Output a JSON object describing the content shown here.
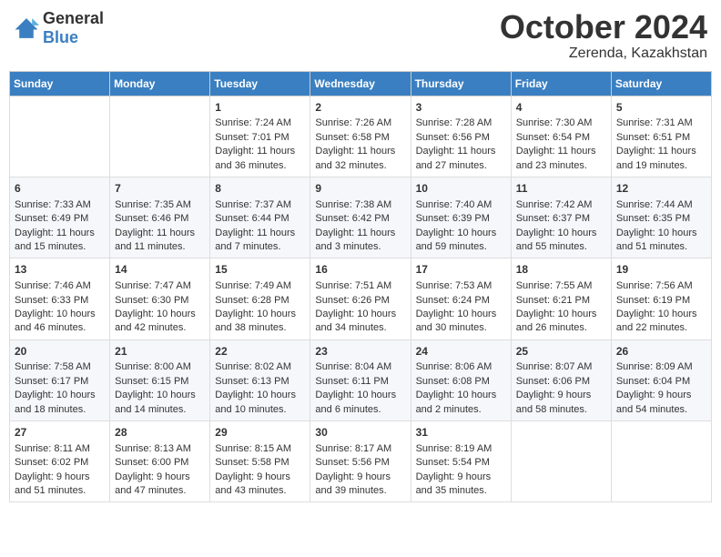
{
  "logo": {
    "general": "General",
    "blue": "Blue"
  },
  "title": "October 2024",
  "location": "Zerenda, Kazakhstan",
  "days_of_week": [
    "Sunday",
    "Monday",
    "Tuesday",
    "Wednesday",
    "Thursday",
    "Friday",
    "Saturday"
  ],
  "weeks": [
    [
      {
        "day": "",
        "sunrise": "",
        "sunset": "",
        "daylight": ""
      },
      {
        "day": "",
        "sunrise": "",
        "sunset": "",
        "daylight": ""
      },
      {
        "day": "1",
        "sunrise": "Sunrise: 7:24 AM",
        "sunset": "Sunset: 7:01 PM",
        "daylight": "Daylight: 11 hours and 36 minutes."
      },
      {
        "day": "2",
        "sunrise": "Sunrise: 7:26 AM",
        "sunset": "Sunset: 6:58 PM",
        "daylight": "Daylight: 11 hours and 32 minutes."
      },
      {
        "day": "3",
        "sunrise": "Sunrise: 7:28 AM",
        "sunset": "Sunset: 6:56 PM",
        "daylight": "Daylight: 11 hours and 27 minutes."
      },
      {
        "day": "4",
        "sunrise": "Sunrise: 7:30 AM",
        "sunset": "Sunset: 6:54 PM",
        "daylight": "Daylight: 11 hours and 23 minutes."
      },
      {
        "day": "5",
        "sunrise": "Sunrise: 7:31 AM",
        "sunset": "Sunset: 6:51 PM",
        "daylight": "Daylight: 11 hours and 19 minutes."
      }
    ],
    [
      {
        "day": "6",
        "sunrise": "Sunrise: 7:33 AM",
        "sunset": "Sunset: 6:49 PM",
        "daylight": "Daylight: 11 hours and 15 minutes."
      },
      {
        "day": "7",
        "sunrise": "Sunrise: 7:35 AM",
        "sunset": "Sunset: 6:46 PM",
        "daylight": "Daylight: 11 hours and 11 minutes."
      },
      {
        "day": "8",
        "sunrise": "Sunrise: 7:37 AM",
        "sunset": "Sunset: 6:44 PM",
        "daylight": "Daylight: 11 hours and 7 minutes."
      },
      {
        "day": "9",
        "sunrise": "Sunrise: 7:38 AM",
        "sunset": "Sunset: 6:42 PM",
        "daylight": "Daylight: 11 hours and 3 minutes."
      },
      {
        "day": "10",
        "sunrise": "Sunrise: 7:40 AM",
        "sunset": "Sunset: 6:39 PM",
        "daylight": "Daylight: 10 hours and 59 minutes."
      },
      {
        "day": "11",
        "sunrise": "Sunrise: 7:42 AM",
        "sunset": "Sunset: 6:37 PM",
        "daylight": "Daylight: 10 hours and 55 minutes."
      },
      {
        "day": "12",
        "sunrise": "Sunrise: 7:44 AM",
        "sunset": "Sunset: 6:35 PM",
        "daylight": "Daylight: 10 hours and 51 minutes."
      }
    ],
    [
      {
        "day": "13",
        "sunrise": "Sunrise: 7:46 AM",
        "sunset": "Sunset: 6:33 PM",
        "daylight": "Daylight: 10 hours and 46 minutes."
      },
      {
        "day": "14",
        "sunrise": "Sunrise: 7:47 AM",
        "sunset": "Sunset: 6:30 PM",
        "daylight": "Daylight: 10 hours and 42 minutes."
      },
      {
        "day": "15",
        "sunrise": "Sunrise: 7:49 AM",
        "sunset": "Sunset: 6:28 PM",
        "daylight": "Daylight: 10 hours and 38 minutes."
      },
      {
        "day": "16",
        "sunrise": "Sunrise: 7:51 AM",
        "sunset": "Sunset: 6:26 PM",
        "daylight": "Daylight: 10 hours and 34 minutes."
      },
      {
        "day": "17",
        "sunrise": "Sunrise: 7:53 AM",
        "sunset": "Sunset: 6:24 PM",
        "daylight": "Daylight: 10 hours and 30 minutes."
      },
      {
        "day": "18",
        "sunrise": "Sunrise: 7:55 AM",
        "sunset": "Sunset: 6:21 PM",
        "daylight": "Daylight: 10 hours and 26 minutes."
      },
      {
        "day": "19",
        "sunrise": "Sunrise: 7:56 AM",
        "sunset": "Sunset: 6:19 PM",
        "daylight": "Daylight: 10 hours and 22 minutes."
      }
    ],
    [
      {
        "day": "20",
        "sunrise": "Sunrise: 7:58 AM",
        "sunset": "Sunset: 6:17 PM",
        "daylight": "Daylight: 10 hours and 18 minutes."
      },
      {
        "day": "21",
        "sunrise": "Sunrise: 8:00 AM",
        "sunset": "Sunset: 6:15 PM",
        "daylight": "Daylight: 10 hours and 14 minutes."
      },
      {
        "day": "22",
        "sunrise": "Sunrise: 8:02 AM",
        "sunset": "Sunset: 6:13 PM",
        "daylight": "Daylight: 10 hours and 10 minutes."
      },
      {
        "day": "23",
        "sunrise": "Sunrise: 8:04 AM",
        "sunset": "Sunset: 6:11 PM",
        "daylight": "Daylight: 10 hours and 6 minutes."
      },
      {
        "day": "24",
        "sunrise": "Sunrise: 8:06 AM",
        "sunset": "Sunset: 6:08 PM",
        "daylight": "Daylight: 10 hours and 2 minutes."
      },
      {
        "day": "25",
        "sunrise": "Sunrise: 8:07 AM",
        "sunset": "Sunset: 6:06 PM",
        "daylight": "Daylight: 9 hours and 58 minutes."
      },
      {
        "day": "26",
        "sunrise": "Sunrise: 8:09 AM",
        "sunset": "Sunset: 6:04 PM",
        "daylight": "Daylight: 9 hours and 54 minutes."
      }
    ],
    [
      {
        "day": "27",
        "sunrise": "Sunrise: 8:11 AM",
        "sunset": "Sunset: 6:02 PM",
        "daylight": "Daylight: 9 hours and 51 minutes."
      },
      {
        "day": "28",
        "sunrise": "Sunrise: 8:13 AM",
        "sunset": "Sunset: 6:00 PM",
        "daylight": "Daylight: 9 hours and 47 minutes."
      },
      {
        "day": "29",
        "sunrise": "Sunrise: 8:15 AM",
        "sunset": "Sunset: 5:58 PM",
        "daylight": "Daylight: 9 hours and 43 minutes."
      },
      {
        "day": "30",
        "sunrise": "Sunrise: 8:17 AM",
        "sunset": "Sunset: 5:56 PM",
        "daylight": "Daylight: 9 hours and 39 minutes."
      },
      {
        "day": "31",
        "sunrise": "Sunrise: 8:19 AM",
        "sunset": "Sunset: 5:54 PM",
        "daylight": "Daylight: 9 hours and 35 minutes."
      },
      {
        "day": "",
        "sunrise": "",
        "sunset": "",
        "daylight": ""
      },
      {
        "day": "",
        "sunrise": "",
        "sunset": "",
        "daylight": ""
      }
    ]
  ]
}
